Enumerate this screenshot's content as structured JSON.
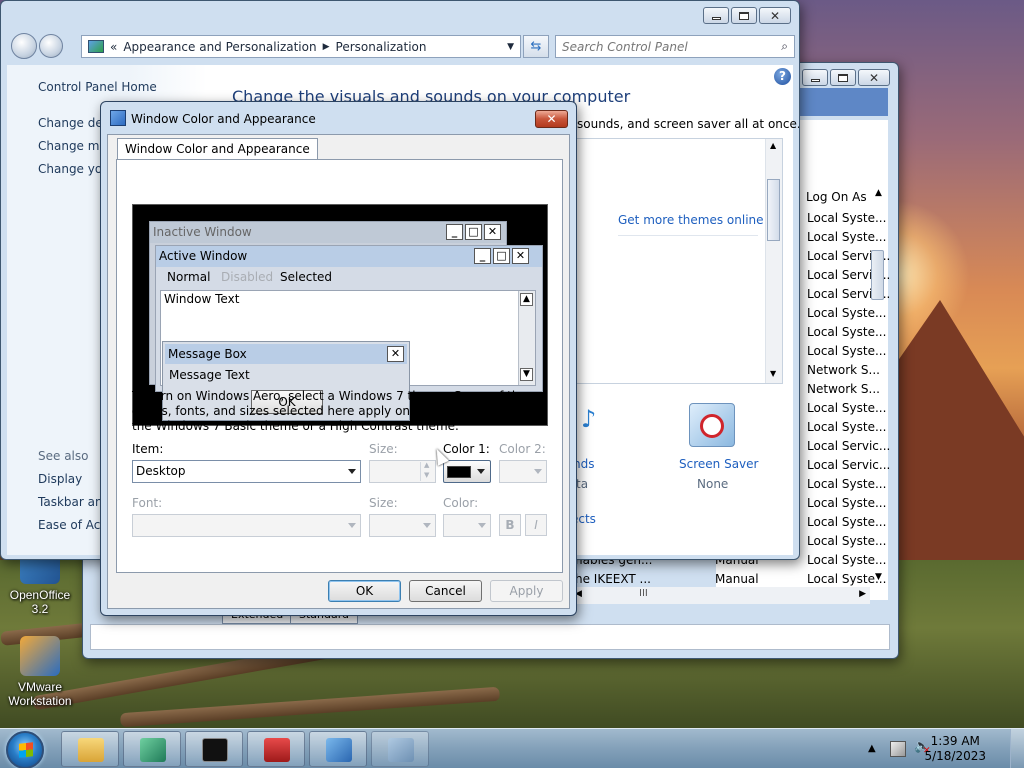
{
  "desktop": {
    "icons": [
      {
        "label": "OpenOffice 3.2"
      },
      {
        "label": "VMware Workstation"
      }
    ]
  },
  "services_window": {
    "column_header": "Log On As",
    "log_on_rows": [
      "Local Syste...",
      "Local Syste...",
      "Local Servic...",
      "Local Servic...",
      "Local Servic...",
      "Local Syste...",
      "Local Syste...",
      "Local Syste...",
      "Network S...",
      "Network S...",
      "Local Syste...",
      "Local Syste...",
      "Local Servic...",
      "Local Servic...",
      "Local Syste...",
      "Local Syste...",
      "Local Syste...",
      "Local Syste...",
      "Local Syste...",
      "Local Syste..."
    ],
    "bottom_rows": [
      {
        "desc": "nables gen...",
        "startup": "Manual"
      },
      {
        "desc": "he IKEEXT ...",
        "startup": "Manual"
      }
    ],
    "tabs": [
      "Extended",
      "Standard"
    ],
    "hscroll_label": "III"
  },
  "personalization": {
    "breadcrumb": {
      "sep": "«",
      "items": [
        "Appearance and Personalization",
        "Personalization"
      ]
    },
    "search_placeholder": "Search Control Panel",
    "side": {
      "home": "Control Panel Home",
      "links": [
        "Change des",
        "Change mo",
        "Change you"
      ],
      "see_also_head": "See also",
      "see_also": [
        "Display",
        "Taskbar and",
        "Ease of Acce"
      ]
    },
    "title": "Change the visuals and sounds on your computer",
    "subtitle": "sounds, and screen saver all at once.",
    "themes_link": "Get more themes online",
    "bottom": {
      "sounds_label": "nds",
      "sounds_sub": "ta",
      "effects_label": "ects",
      "screensaver_label": "Screen Saver",
      "screensaver_sub": "None"
    },
    "help": "?"
  },
  "dialog": {
    "title": "Window Color and Appearance",
    "tab": "Window Color and Appearance",
    "preview": {
      "inactive": "Inactive Window",
      "active": "Active Window",
      "menu_normal": "Normal",
      "menu_disabled": "Disabled",
      "menu_selected": "Selected",
      "window_text": "Window Text",
      "msgbox_title": "Message Box",
      "msgbox_text": "Message Text",
      "msgbox_ok": "OK"
    },
    "info": "To turn on Windows Aero, select a Windows 7 theme.  Some of the colors, fonts, and sizes selected here apply only if you have selected the Windows 7 Basic theme or a High Contrast theme.",
    "item_label": "Item:",
    "item_value": "Desktop",
    "size_label": "Size:",
    "color1_label": "Color 1:",
    "color2_label": "Color 2:",
    "font_label": "Font:",
    "font_size_label": "Size:",
    "font_color_label": "Color:",
    "bold_label": "B",
    "italic_label": "I",
    "color1_value": "#000000",
    "ok": "OK",
    "cancel": "Cancel",
    "apply": "Apply"
  },
  "taskbar": {
    "clock_time": "1:39 AM",
    "clock_date": "5/18/2023"
  }
}
